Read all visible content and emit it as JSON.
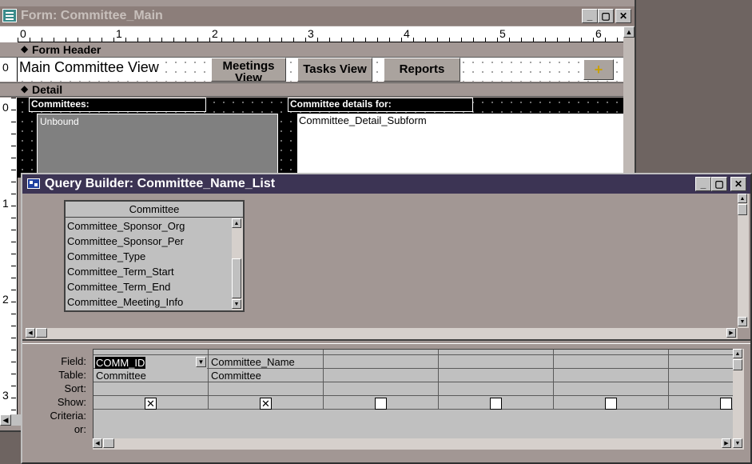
{
  "form_window": {
    "title": "Form: Committee_Main",
    "ruler_numbers": [
      "0",
      "1",
      "2",
      "3",
      "4",
      "5",
      "6"
    ],
    "form_header_label": "Form Header",
    "detail_label": "Detail",
    "vruler_header": "0",
    "vruler_detail": [
      "0",
      "1",
      "2",
      "3"
    ],
    "header_textbox": "Main Committee View",
    "buttons": {
      "meetings": "Meetings View",
      "tasks": "Tasks View",
      "reports": "Reports",
      "add": "+"
    },
    "committees_label": "Committees:",
    "listbox_value": "Unbound",
    "details_label": "Committee details for:",
    "subform_name": "Committee_Detail_Subform"
  },
  "query_builder": {
    "title": "Query Builder: Committee_Name_List",
    "table": {
      "name": "Committee",
      "fields": [
        "Committee_Sponsor_Org",
        "Committee_Sponsor_Per",
        "Committee_Type",
        "Committee_Term_Start",
        "Committee_Term_End",
        "Committee_Meeting_Info"
      ]
    },
    "grid": {
      "row_labels": [
        "Field:",
        "Table:",
        "Sort:",
        "Show:",
        "Criteria:",
        "or:"
      ],
      "columns": [
        {
          "field": "COMM_ID",
          "table": "Committee",
          "show": true
        },
        {
          "field": "Committee_Name",
          "table": "Committee",
          "show": true
        },
        {
          "field": "",
          "table": "",
          "show": false
        },
        {
          "field": "",
          "table": "",
          "show": false
        },
        {
          "field": "",
          "table": "",
          "show": false
        },
        {
          "field": "",
          "table": "",
          "show": false
        }
      ]
    }
  },
  "colors": {
    "inactive_title": "#8c7e7a",
    "active_title": "#3c3454",
    "client_bg": "#a29794"
  }
}
